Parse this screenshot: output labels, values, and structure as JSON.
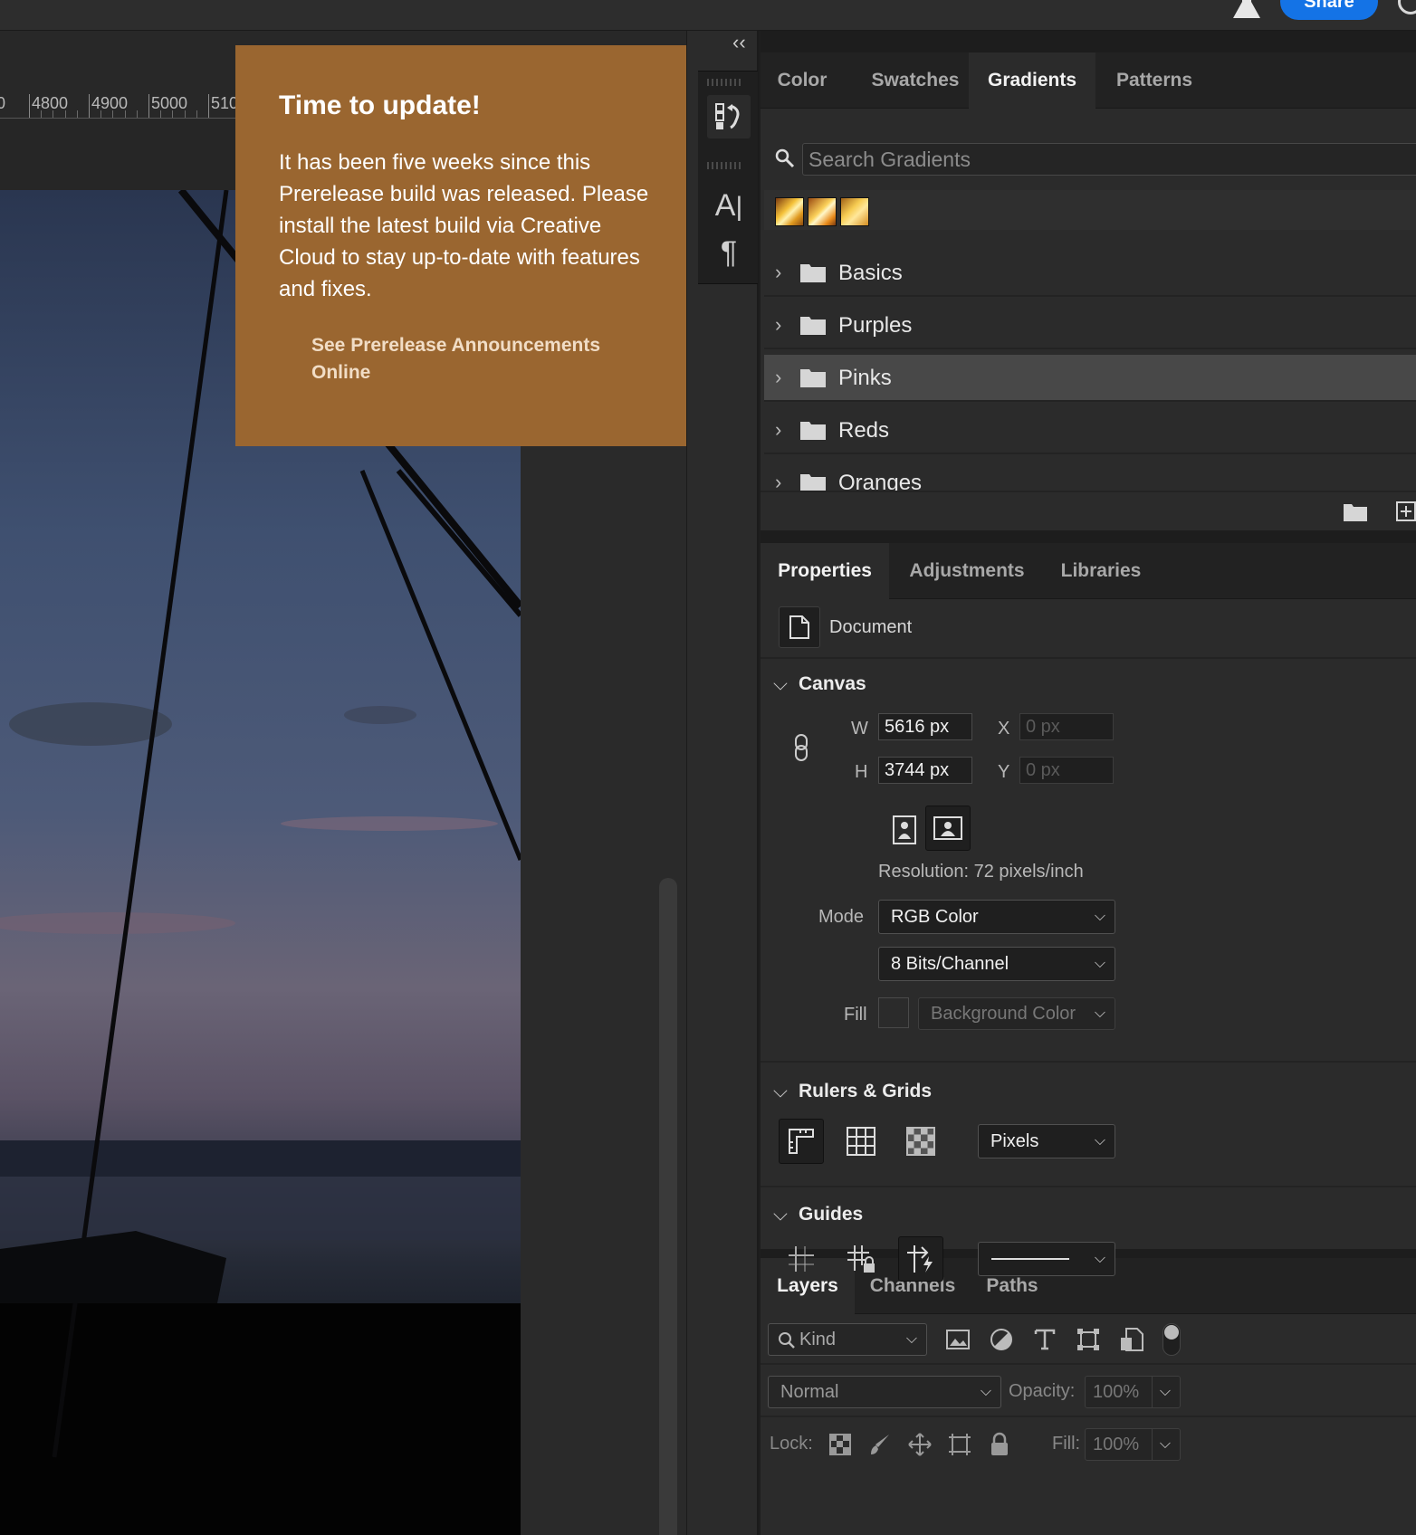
{
  "topbar": {
    "share_label": "Share"
  },
  "ruler": {
    "labels": [
      "0",
      "4800",
      "4900",
      "5000",
      "510"
    ]
  },
  "tooltip": {
    "title": "Time to update!",
    "body": "It has been five weeks since this Prerelease build was released. Please install the latest build via Creative Cloud to stay up-to-date with features and fixes.",
    "link": "See Prerelease Announcements Online",
    "color": "#9a6630"
  },
  "gradients_panel": {
    "tabs": [
      "Color",
      "Swatches",
      "Gradients",
      "Patterns"
    ],
    "active_tab": "Gradients",
    "search_placeholder": "Search Gradients",
    "folders": [
      "Basics",
      "Purples",
      "Pinks",
      "Reds",
      "Oranges"
    ],
    "selected_folder": "Pinks"
  },
  "properties_panel": {
    "tabs": [
      "Properties",
      "Adjustments",
      "Libraries"
    ],
    "active_tab": "Properties",
    "doc_label": "Document",
    "canvas": {
      "title": "Canvas",
      "w_label": "W",
      "w_value": "5616 px",
      "h_label": "H",
      "h_value": "3744 px",
      "x_label": "X",
      "x_value": "0 px",
      "y_label": "Y",
      "y_value": "0 px",
      "resolution": "Resolution: 72 pixels/inch",
      "mode_label": "Mode",
      "mode_value": "RGB Color",
      "bits_value": "8 Bits/Channel",
      "fill_label": "Fill",
      "fill_value": "Background Color"
    },
    "rulers": {
      "title": "Rulers & Grids",
      "units": "Pixels"
    },
    "guides": {
      "title": "Guides"
    }
  },
  "layers_panel": {
    "tabs": [
      "Layers",
      "Channels",
      "Paths"
    ],
    "active_tab": "Layers",
    "filter_label": "Kind",
    "blend_mode": "Normal",
    "opacity_label": "Opacity:",
    "opacity_value": "100%",
    "lock_label": "Lock:",
    "fill_label": "Fill:",
    "fill_value": "100%"
  }
}
